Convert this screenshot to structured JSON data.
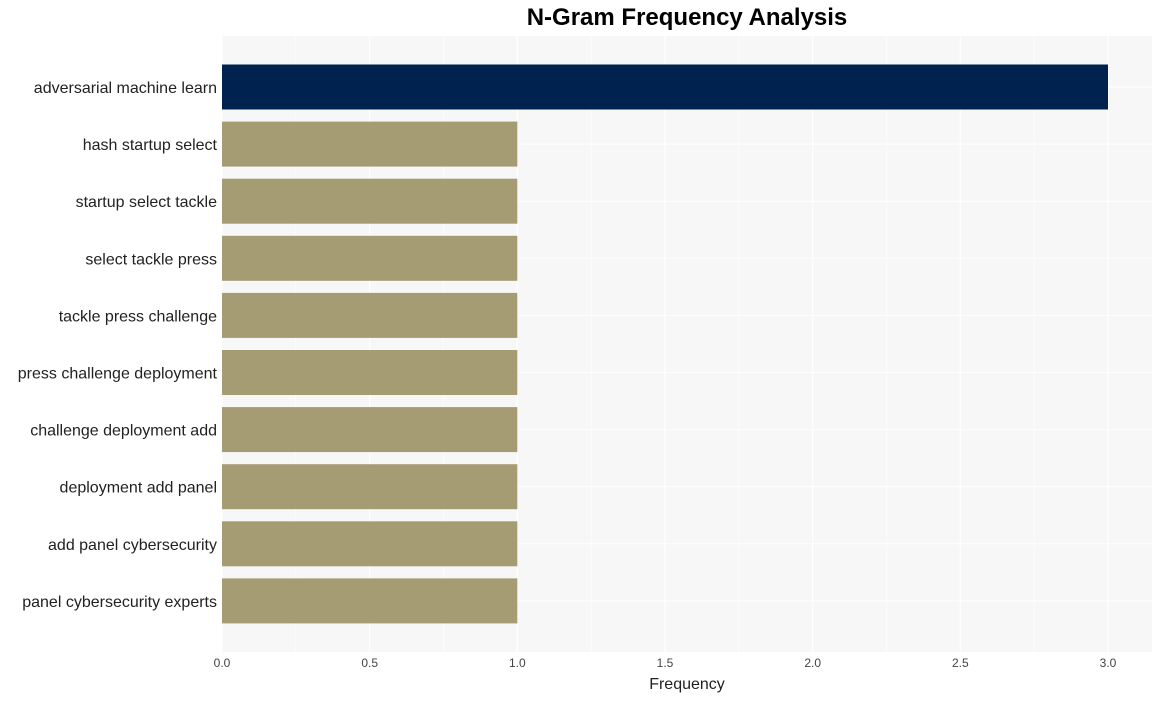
{
  "chart_data": {
    "type": "bar",
    "orientation": "horizontal",
    "title": "N-Gram Frequency Analysis",
    "xlabel": "Frequency",
    "ylabel": "",
    "categories": [
      "adversarial machine learn",
      "hash startup select",
      "startup select tackle",
      "select tackle press",
      "tackle press challenge",
      "press challenge deployment",
      "challenge deployment add",
      "deployment add panel",
      "add panel cybersecurity",
      "panel cybersecurity experts"
    ],
    "values": [
      3,
      1,
      1,
      1,
      1,
      1,
      1,
      1,
      1,
      1
    ],
    "colors": [
      "#00224e",
      "#a59c74",
      "#a59c74",
      "#a59c74",
      "#a59c74",
      "#a59c74",
      "#a59c74",
      "#a59c74",
      "#a59c74",
      "#a59c74"
    ],
    "xlim": [
      0,
      3.15
    ],
    "xticks": [
      0.0,
      0.5,
      1.0,
      1.5,
      2.0,
      2.5,
      3.0
    ],
    "xtick_labels": [
      "0.0",
      "0.5",
      "1.0",
      "1.5",
      "2.0",
      "2.5",
      "3.0"
    ],
    "grid": true,
    "plot_background": "#f7f7f7",
    "gridline_color": "#ffffff",
    "legend": "none"
  }
}
